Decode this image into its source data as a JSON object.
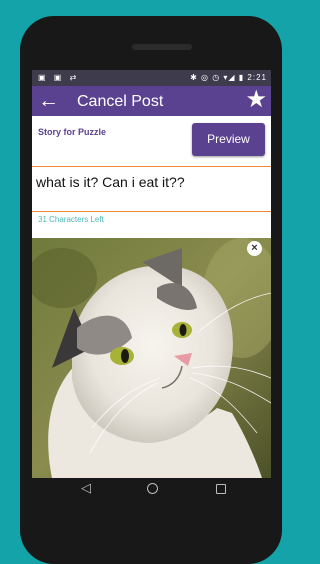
{
  "statusbar": {
    "left_icons": "▣ ▣ ⇄",
    "right_icons": "✱ ◎ ◷ ▾◢ ▮",
    "time": "2:21"
  },
  "appbar": {
    "back_icon": "←",
    "title": "Cancel Post",
    "star_icon": "★"
  },
  "story": {
    "label": "Story for Puzzle"
  },
  "preview_button": {
    "label": "Preview"
  },
  "post_input": {
    "value": "what is it? Can i eat it??"
  },
  "chars_left": "31 Characters Left",
  "photo": {
    "subject": "cat-photo",
    "close_icon": "×"
  },
  "navbar": {
    "back_icon": "◁"
  },
  "colors": {
    "primary": "#5b4291",
    "accent": "#f08a3a",
    "teal": "#4fb7b8",
    "background": "#13a3a9"
  }
}
